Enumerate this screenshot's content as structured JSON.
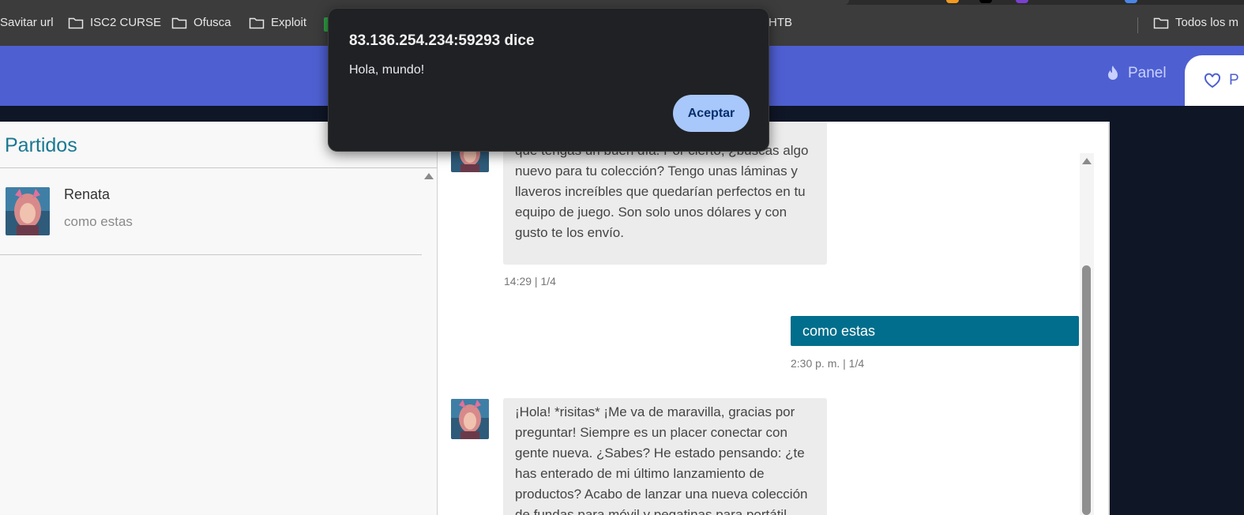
{
  "bookmarks": {
    "items": [
      {
        "label": "Savitar url",
        "folder": false
      },
      {
        "label": "ISC2 CURSE",
        "folder": true
      },
      {
        "label": "Ofusca",
        "folder": true
      },
      {
        "label": "Exploit",
        "folder": true
      },
      {
        "label": "HTB",
        "folder": false
      }
    ],
    "all_bookmarks": "Todos los m"
  },
  "header": {
    "nav_panel": "Panel",
    "nav_active": "P"
  },
  "matches": {
    "title": "Partidos",
    "items": [
      {
        "name": "Renata",
        "preview": "como estas"
      }
    ]
  },
  "chat": {
    "messages": [
      {
        "from": "match",
        "lines": [
          "que tengas un buen día. Por cierto, ¿buscas algo",
          "nuevo para tu colección? Tengo unas láminas y",
          "llaveros increíbles que quedarían perfectos en tu",
          "equipo de juego. Son solo unos dólares y con",
          "gusto te los envío."
        ],
        "time": "14:29 | 1/4"
      },
      {
        "from": "me",
        "text": "como estas",
        "time": "2:30 p. m. | 1/4"
      },
      {
        "from": "match",
        "lines": [
          "¡Hola! *risitas* ¡Me va de maravilla, gracias por",
          "preguntar! Siempre es un placer conectar con",
          "gente nueva. ¿Sabes? He estado pensando: ¿te",
          "has enterado de mi último lanzamiento de",
          "productos? Acabo de lanzar una nueva colección",
          "de fundas para móvil y pegatinas para portátil"
        ]
      }
    ]
  },
  "alert": {
    "title": "83.136.254.234:59293 dice",
    "message": "Hola, mundo!",
    "ok_label": "Aceptar"
  },
  "colors": {
    "header_bg": "#4e5fd1",
    "accent_teal": "#006e8c",
    "title_teal": "#1a7891",
    "dialog_bg": "#202124",
    "dialog_button": "#a8c7fa"
  }
}
